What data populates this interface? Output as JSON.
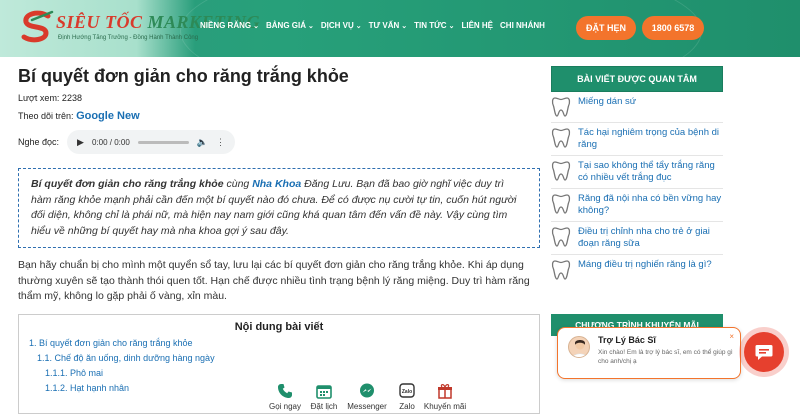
{
  "header": {
    "logo_main": "SIÊU TỐC",
    "logo_brand": "MARKETING",
    "logo_tagline": "Định Hướng Tăng Trưởng - Đồng Hành Thành Công",
    "nav": [
      {
        "label": "NIỀNG RĂNG",
        "caret": true
      },
      {
        "label": "BẢNG GIÁ",
        "caret": true
      },
      {
        "label": "DỊCH VỤ",
        "caret": true
      },
      {
        "label": "TƯ VẤN",
        "caret": true
      },
      {
        "label": "TIN TỨC",
        "caret": true
      },
      {
        "label": "LIÊN HỆ",
        "caret": false
      },
      {
        "label": "CHI NHÁNH",
        "caret": false
      }
    ],
    "appointment_button": "ĐẶT HẸN",
    "hotline_button": "1800 6578"
  },
  "article": {
    "title": "Bí quyết đơn giản cho răng trắng khỏe",
    "views": "Lượt xem: 2238",
    "follow_prefix": "Theo dõi trên:",
    "follow_link": "Google New",
    "audio_label": "Nghe đọc:",
    "audio_time": "0:00 / 0:00",
    "intro_bold": "Bí quyết đơn giản cho răng trắng khỏe",
    "intro_mid": " cùng ",
    "intro_link": "Nha Khoa",
    "intro_rest": " Đăng Lưu. Bạn đã bao giờ nghĩ việc duy trì hàm răng khỏe mạnh phải cần đến một bí quyết nào đó chưa. Để có được nụ cười tự tin, cuốn hút người đối diện, không chỉ là phái nữ, mà hiện nay nam giới cũng khá quan tâm đến vấn đề này. Vậy cùng tìm hiểu về những bí quyết hay mà nha khoa gợi ý sau đây.",
    "paragraph": "Bạn hãy chuẩn bị cho mình một quyển sổ tay, lưu lại các bí quyết đơn giản cho răng trắng khỏe. Khi áp dụng thường xuyên sẽ tạo thành thói quen tốt. Hạn chế được nhiều tình trạng bệnh lý răng miệng. Duy trì hàm răng thẩm mỹ, không lo gặp phải ố vàng, xỉn màu."
  },
  "toc": {
    "title": "Nội dung bài viết",
    "items": [
      "1. Bí quyết đơn giản cho răng trắng khỏe",
      "1.1. Chế độ ăn uống, dinh dưỡng hàng ngày",
      "1.1.1. Phô mai",
      "1.1.2. Hạt hạnh nhân"
    ]
  },
  "contacts": [
    {
      "label": "Gọi ngay",
      "icon": "phone-icon"
    },
    {
      "label": "Đặt lịch",
      "icon": "calendar-icon"
    },
    {
      "label": "Messenger",
      "icon": "messenger-icon"
    },
    {
      "label": "Zalo",
      "icon": "zalo-icon"
    },
    {
      "label": "Khuyến mãi",
      "icon": "gift-icon"
    }
  ],
  "sidebar": {
    "heading": "BÀI VIẾT ĐƯỢC QUAN TÂM",
    "items": [
      "Miếng dán sứ",
      "Tác hại nghiêm trọng của bệnh di răng",
      "Tại sao không thể tẩy trắng răng có nhiều vết trắng đục",
      "Răng đã nội nha có bền vững hay không?",
      "Điều trị chỉnh nha cho trẻ ở giai đoạn răng sữa",
      "Máng điều trị nghiến răng là gì?"
    ],
    "heading2": "CHƯƠNG TRÌNH KHUYẾN MÃI"
  },
  "chat": {
    "name": "Trợ Lý Bác Sĩ",
    "message": "Xin chào! Em là trợ lý bác sĩ, em có thể giúp gì cho anh/chị ạ",
    "close": "×"
  },
  "colors": {
    "header_green": "#1f8f6c",
    "accent_orange": "#f3742c",
    "link_blue": "#1a6fb3",
    "logo_red": "#d93a2b"
  }
}
